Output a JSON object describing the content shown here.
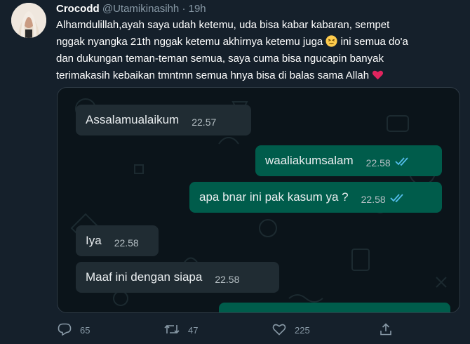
{
  "tweet": {
    "display_name": "Crocodd",
    "handle": "@Utamikinasihh",
    "separator": "·",
    "time": "19h",
    "text_before_emoji": "Alhamdulillah,ayah saya udah ketemu, uda bisa kabar kabaran, sempet\nnggak nyangka 21th nggak ketemu akhirnya ketemu juga ",
    "text_after_emoji": " ini semua do'a\ndan dukungan teman-teman semua,  saya cuma bisa ngucapin banyak\nterimakasih kebaikan tmntmn semua hnya bisa di balas sama Allah ",
    "emoji_1": "persevering-face-emoji",
    "emoji_2": "red-heart-emoji"
  },
  "chat": {
    "messages": [
      {
        "direction": "incoming",
        "text": "Assalamualaikum",
        "time": "22.57"
      },
      {
        "direction": "outgoing",
        "text": "waaliakumsalam",
        "time": "22.58",
        "status": "read-double-tick"
      },
      {
        "direction": "outgoing",
        "text": "apa bnar ini pak kasum ya ?",
        "time": "22.58",
        "status": "read-double-tick"
      },
      {
        "direction": "incoming",
        "text": "Iya",
        "time": "22.58"
      },
      {
        "direction": "incoming",
        "text": "Maaf ini dengan siapa",
        "time": "22.58"
      }
    ],
    "colors": {
      "incoming": "#202c33",
      "outgoing": "#005c4b",
      "tick": "#53bdeb"
    }
  },
  "actions": {
    "reply_count": "65",
    "retweet_count": "47",
    "like_count": "225",
    "reply_icon": "reply-icon",
    "retweet_icon": "retweet-icon",
    "like_icon": "heart-icon",
    "share_icon": "share-icon"
  }
}
